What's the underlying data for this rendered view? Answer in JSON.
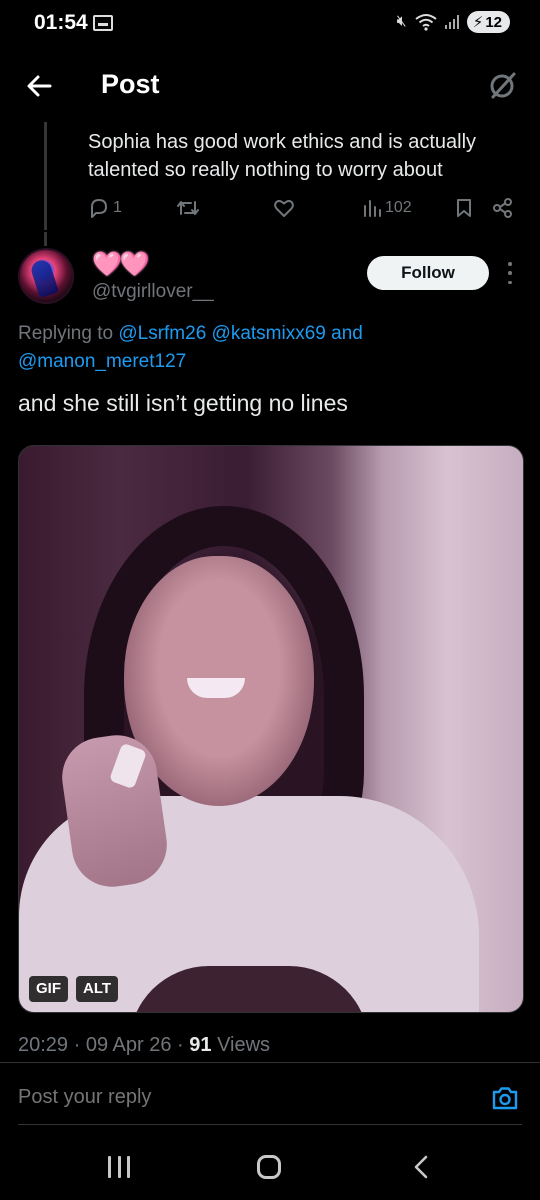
{
  "status_bar": {
    "time": "01:54",
    "battery": "12"
  },
  "header": {
    "title": "Post"
  },
  "parent_post": {
    "text": "Sophia has good work ethics and is actually talented so really nothing to worry about",
    "replies": "1",
    "views": "102"
  },
  "post": {
    "display_name": "🩷🩷",
    "handle": "@tvgirllover__",
    "follow_label": "Follow",
    "replying_prefix": "Replying to",
    "mention_1": "@Lsrfm26",
    "mention_2": "@katsmixx69",
    "and_word": "and",
    "mention_3": "@manon_meret127",
    "text": "and she still isn’t getting no lines",
    "media": {
      "gif_badge": "GIF",
      "alt_badge": "ALT"
    },
    "time": "20:29",
    "date": "09 Apr 26",
    "views_count": "91",
    "views_label": "Views"
  },
  "reply_bar": {
    "placeholder": "Post your reply"
  },
  "icons": {
    "back": "arrow-left-icon",
    "grok": "grok-icon",
    "reply": "reply-icon",
    "repost": "repost-icon",
    "like": "heart-icon",
    "views": "views-icon",
    "bookmark": "bookmark-icon",
    "share": "share-icon",
    "camera": "camera-icon",
    "more": "more-vertical-icon"
  },
  "colors": {
    "accent": "#1d9bf0",
    "muted": "#71767b",
    "background": "#000000"
  }
}
